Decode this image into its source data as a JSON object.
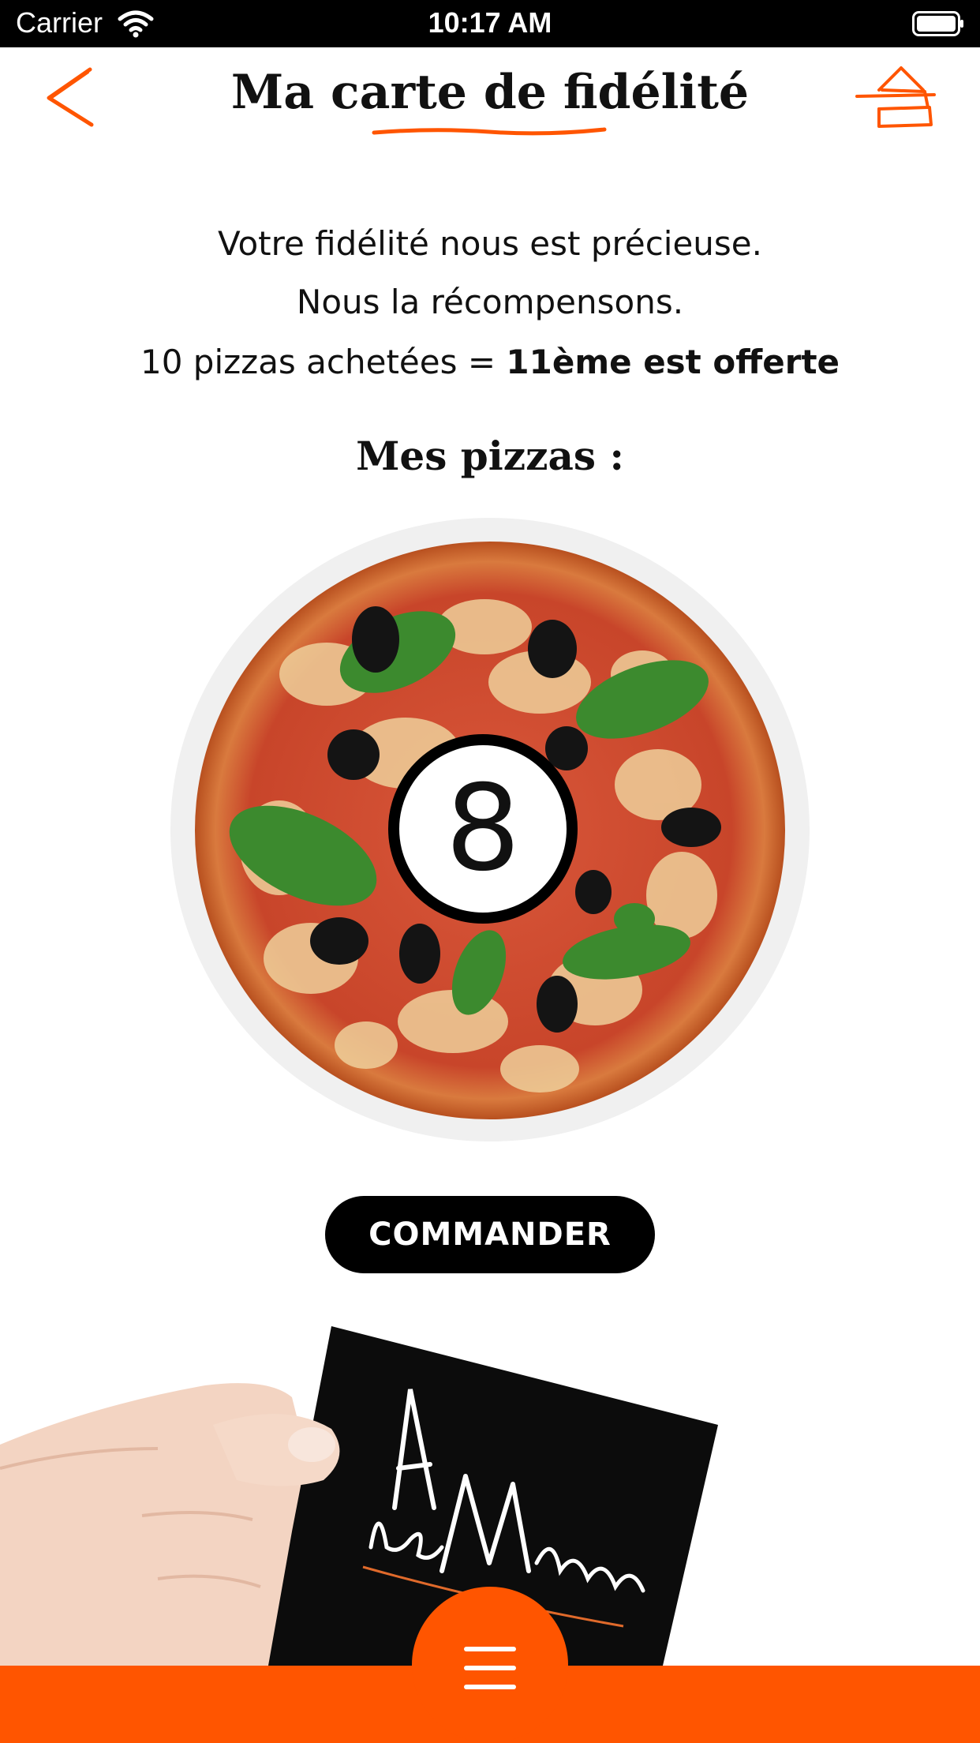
{
  "status_bar": {
    "carrier": "Carrier",
    "time": "10:17 AM"
  },
  "header": {
    "title": "Ma carte de fidélité",
    "back_icon": "chevron-left-icon",
    "home_icon": "home-icon"
  },
  "intro": {
    "line1": "Votre fidélité nous est précieuse.",
    "line2": "Nous la récompensons."
  },
  "rule": {
    "prefix": "10 pizzas achetées = ",
    "reward": "11ème est offerte"
  },
  "section_title": "Mes pizzas :",
  "loyalty": {
    "count": "8"
  },
  "order_button": {
    "label": "COMMANDER"
  },
  "card": {
    "logo_text": "A la Maison"
  },
  "bottom_nav": {
    "menu_icon": "hamburger-menu-icon"
  },
  "colors": {
    "accent": "#FF5500",
    "text": "#111111",
    "button_bg": "#000000"
  }
}
